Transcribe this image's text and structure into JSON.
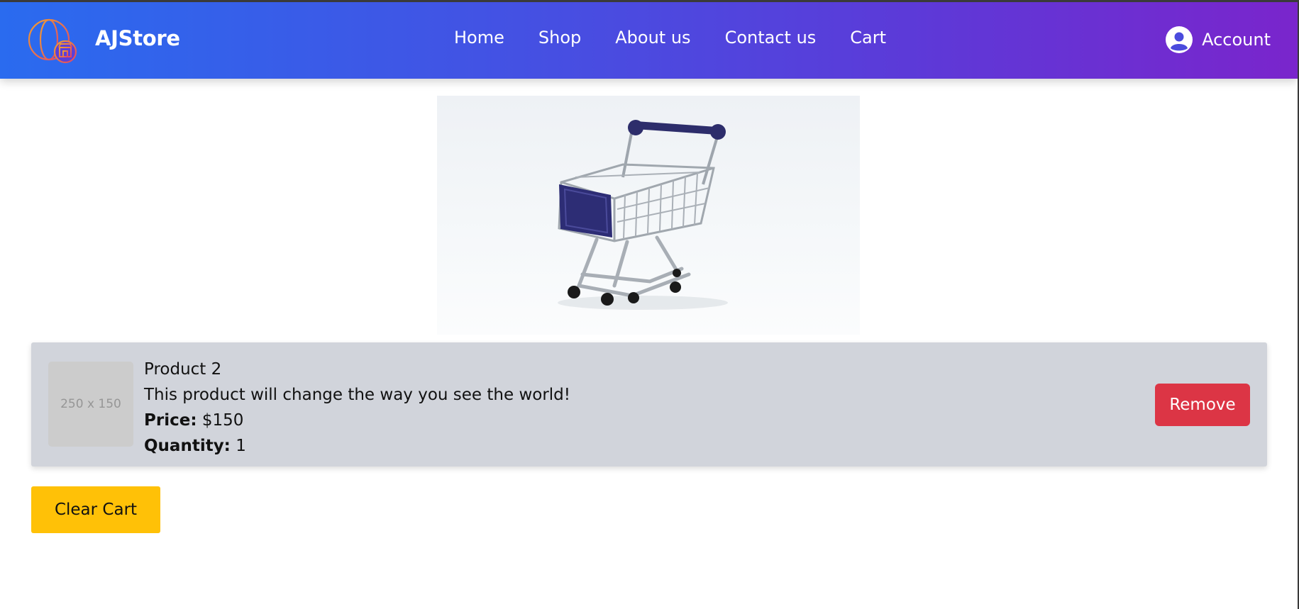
{
  "brand": {
    "name": "AJStore"
  },
  "nav": {
    "links": [
      "Home",
      "Shop",
      "About us",
      "Contact us",
      "Cart"
    ],
    "account_label": "Account"
  },
  "cart": {
    "items": [
      {
        "thumb_placeholder": "250 x 150",
        "name": "Product 2",
        "description": "This product will change the way you see the world!",
        "price_label": "Price:",
        "price": "$150",
        "quantity_label": "Quantity:",
        "quantity": "1",
        "remove_label": "Remove"
      }
    ],
    "clear_label": "Clear Cart"
  },
  "colors": {
    "nav_gradient_start": "#2a6bef",
    "nav_gradient_end": "#7a25cc",
    "remove_button": "#dc3545",
    "clear_button": "#ffc107",
    "cart_item_bg": "#d1d4db"
  }
}
